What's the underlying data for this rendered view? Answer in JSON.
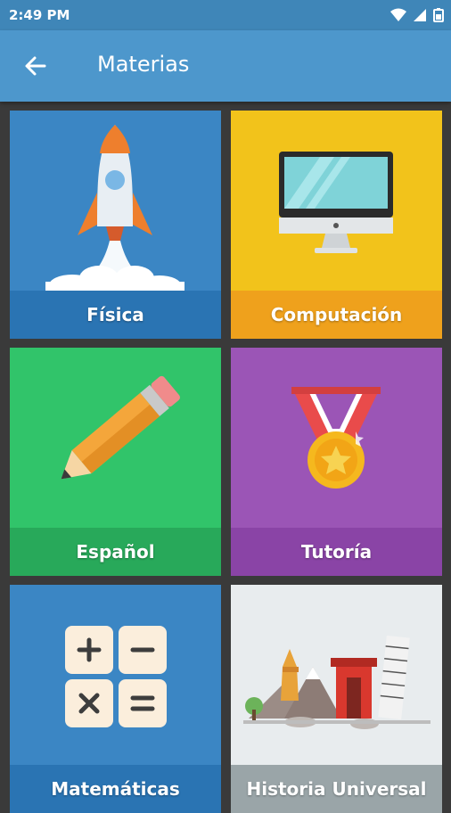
{
  "status_bar": {
    "time": "2:49 PM"
  },
  "app_bar": {
    "title": "Materias"
  },
  "tiles": [
    {
      "label": "Física",
      "icon": "rocket-icon",
      "color": "#3b86c4",
      "band": "#2a74b3"
    },
    {
      "label": "Computación",
      "icon": "monitor-icon",
      "color": "#f2c31b",
      "band": "#efa11c"
    },
    {
      "label": "Español",
      "icon": "pencil-icon",
      "color": "#31c46a",
      "band": "#28a95a"
    },
    {
      "label": "Tutoría",
      "icon": "medal-icon",
      "color": "#9b55b6",
      "band": "#8a44a6"
    },
    {
      "label": "Matemáticas",
      "icon": "calculator-icon",
      "color": "#3b86c4",
      "band": "#2a74b3"
    },
    {
      "label": "Historia Universal",
      "icon": "landmarks-icon",
      "color": "#e8ecee",
      "band": "#9aa5a8"
    }
  ]
}
